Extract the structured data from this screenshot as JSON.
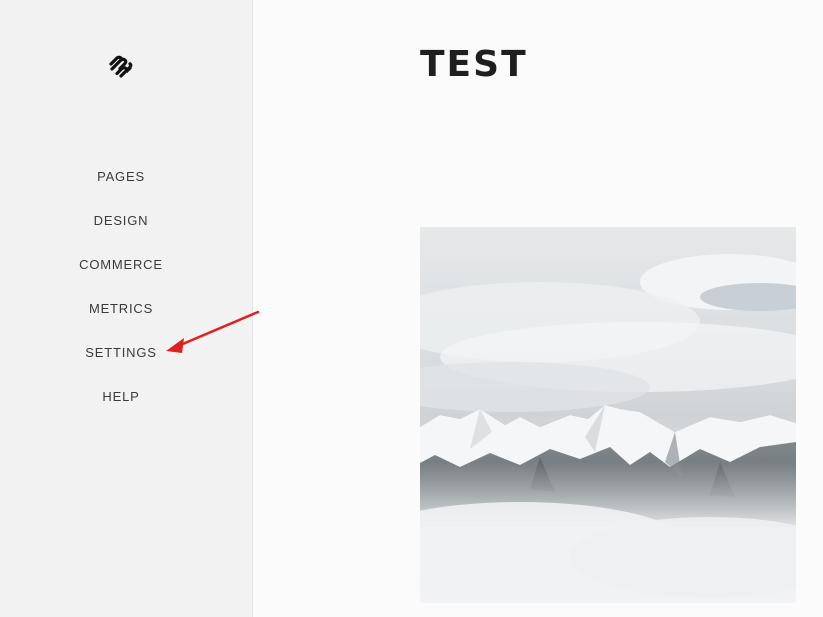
{
  "sidebar": {
    "logo_icon": "squarespace-logo-icon",
    "items": [
      {
        "label": "PAGES"
      },
      {
        "label": "DESIGN"
      },
      {
        "label": "COMMERCE"
      },
      {
        "label": "METRICS"
      },
      {
        "label": "SETTINGS"
      },
      {
        "label": "HELP"
      }
    ]
  },
  "main": {
    "title": "TEST",
    "hero_image": "snowy-mountain-peaks-in-clouds"
  },
  "annotation": {
    "arrow_color": "#e02020",
    "points_to": "SETTINGS"
  }
}
